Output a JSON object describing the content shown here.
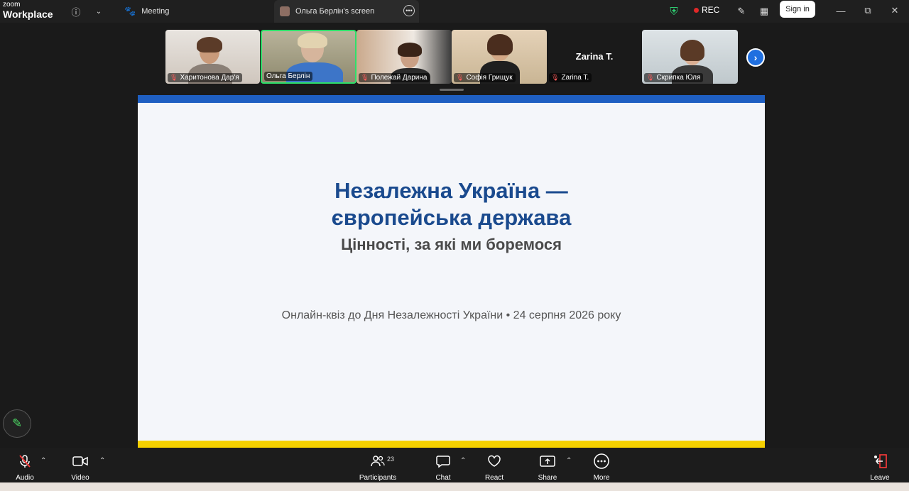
{
  "app": {
    "logo_line1": "zoom",
    "logo_line2": "Workplace",
    "info_icon": "info-icon",
    "chevron_icon": "chevron-down-icon"
  },
  "tabs": [
    {
      "label": "Meeting",
      "icon": "paw-icon"
    },
    {
      "label": "Ольга Берлін's screen",
      "icon": "screen-avatar-icon"
    }
  ],
  "status": {
    "rec_label": "REC",
    "shield_color": "#2ecc71",
    "rec_color": "#e02828"
  },
  "header": {
    "signin_label": "Sign in",
    "minimize": "—",
    "restore": "⧉",
    "close": "✕"
  },
  "participants_strip": [
    {
      "name": "Харитонова Дар'я",
      "muted": true
    },
    {
      "name": "Ольга Берлін",
      "muted": false,
      "active": true
    },
    {
      "name": "Полежай Дарина",
      "muted": true
    },
    {
      "name": "Софія Грищук",
      "muted": true
    },
    {
      "name": "Zarina T.",
      "muted": true,
      "no_video": true,
      "display": "Zarina T."
    },
    {
      "name": "Скрипка Юля",
      "muted": true
    }
  ],
  "slide": {
    "title_line1": "Незалежна Україна —",
    "title_line2": "європейська держава",
    "subtitle": "Цінності, за які ми боремося",
    "footer": "Онлайн-квіз до Дня Незалежності України • 24 серпня 2026 року",
    "top_color": "#1f5fc2",
    "bottom_color": "#f5d000"
  },
  "toolbar": {
    "audio": "Audio",
    "video": "Video",
    "participants": "Participants",
    "participants_count": "23",
    "chat": "Chat",
    "react": "React",
    "share": "Share",
    "more": "More",
    "leave": "Leave"
  }
}
